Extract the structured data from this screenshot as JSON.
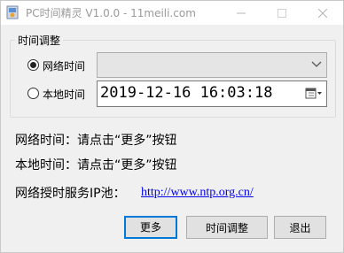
{
  "window": {
    "title": "PC时间精灵 V1.0.0 - 11meili.com"
  },
  "group": {
    "label": "时间调整",
    "network_radio": {
      "label": "网络时间",
      "checked": true
    },
    "local_radio": {
      "label": "本地时间",
      "checked": false
    },
    "network_combo": {
      "value": ""
    },
    "local_datetime": {
      "value": "2019-12-16 16:03:18"
    }
  },
  "info": {
    "network_time": "网络时间：请点击“更多”按钮",
    "local_time": "本地时间：请点击“更多”按钮",
    "ntp_label": "网络授时服务IP池：",
    "ntp_link": "http://www.ntp.org.cn/"
  },
  "buttons": {
    "more": "更多",
    "adjust": "时间调整",
    "exit": "退出"
  },
  "icons": {
    "app": "app-clock-icon",
    "minimize": "minimize-icon",
    "maximize": "maximize-icon",
    "close": "close-icon",
    "dropdown": "chevron-down-icon",
    "calendar": "calendar-icon"
  },
  "colors": {
    "accent": "#0078d7",
    "link": "#0000ee"
  }
}
